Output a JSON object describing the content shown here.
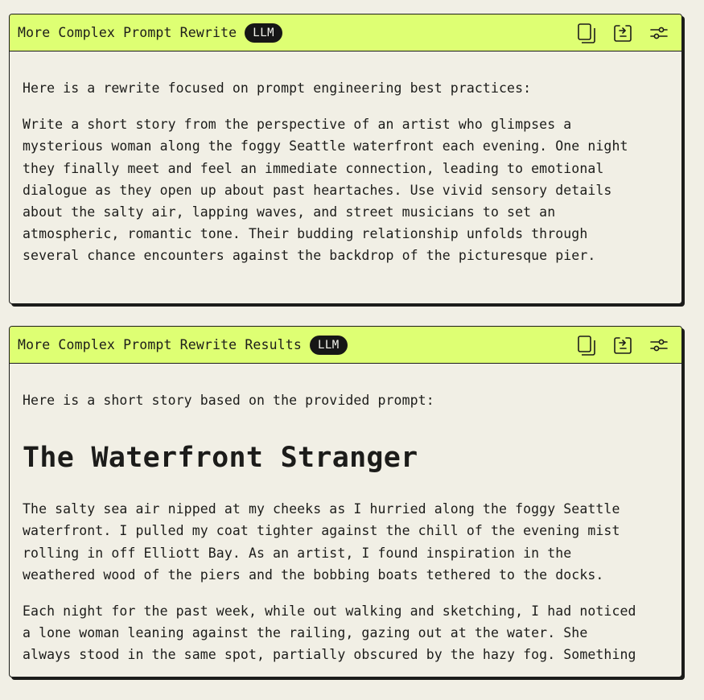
{
  "panels": [
    {
      "title": "More Complex Prompt Rewrite",
      "badge": "LLM",
      "icons": [
        "copy-icon",
        "share-icon",
        "settings-sliders-icon"
      ],
      "intro": "Here is a rewrite focused on prompt engineering best practices:",
      "body": "Write a short story from the perspective of an artist who glimpses a\nmysterious woman along the foggy Seattle waterfront each evening. One night\nthey finally meet and feel an immediate connection, leading to emotional\ndialogue as they open up about past heartaches. Use vivid sensory details\nabout the salty air, lapping waves, and street musicians to set an\natmospheric, romantic tone. Their budding relationship unfolds through\nseveral chance encounters against the backdrop of the picturesque pier."
    },
    {
      "title": "More Complex Prompt Rewrite Results",
      "badge": "LLM",
      "icons": [
        "copy-icon",
        "share-icon",
        "settings-sliders-icon"
      ],
      "intro": "Here is a short story based on the provided prompt:",
      "story_title": "The Waterfront Stranger",
      "paragraphs": [
        "The salty sea air nipped at my cheeks as I hurried along the foggy Seattle\nwaterfront. I pulled my coat tighter against the chill of the evening mist\nrolling in off Elliott Bay. As an artist, I found inspiration in the\nweathered wood of the piers and the bobbing boats tethered to the docks.",
        "Each night for the past week, while out walking and sketching, I had noticed\na lone woman leaning against the railing, gazing out at the water. She\nalways stood in the same spot, partially obscured by the hazy fog. Something"
      ]
    }
  ],
  "colors": {
    "background": "#f1efe5",
    "header": "#deff73",
    "badge": "#161616",
    "text": "#1c1c1a"
  }
}
